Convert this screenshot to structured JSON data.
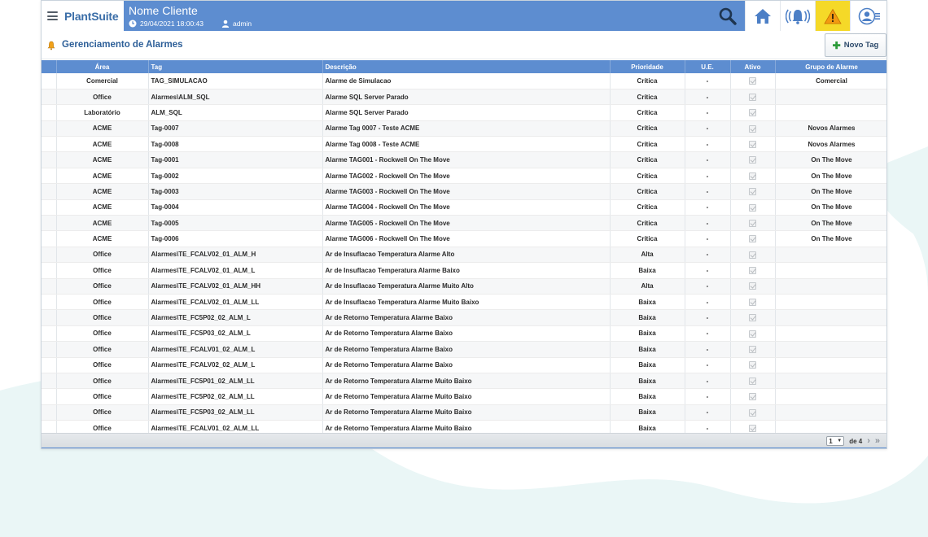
{
  "app": {
    "brand": "PlantSuite",
    "client_name": "Nome Cliente",
    "datetime": "29/04/2021 18:00:43",
    "user": "admin"
  },
  "page": {
    "title": "Gerenciamento de Alarmes",
    "new_button": "Novo Tag"
  },
  "table": {
    "columns": [
      "Área",
      "Tag",
      "Descrição",
      "Prioridade",
      "U.E.",
      "Ativo",
      "Grupo de Alarme"
    ],
    "rows": [
      {
        "area": "Comercial",
        "tag": "TAG_SIMULACAO",
        "desc": "Alarme de Simulacao",
        "prio": "Crítica",
        "ue": "-",
        "grupo": "Comercial"
      },
      {
        "area": "Office",
        "tag": "Alarmes\\ALM_SQL",
        "desc": "Alarme SQL Server Parado",
        "prio": "Crítica",
        "ue": "-",
        "grupo": ""
      },
      {
        "area": "Laboratório",
        "tag": "ALM_SQL",
        "desc": "Alarme SQL Server Parado",
        "prio": "Crítica",
        "ue": "-",
        "grupo": ""
      },
      {
        "area": "ACME",
        "tag": "Tag-0007",
        "desc": "Alarme Tag 0007 - Teste ACME",
        "prio": "Crítica",
        "ue": "-",
        "grupo": "Novos Alarmes"
      },
      {
        "area": "ACME",
        "tag": "Tag-0008",
        "desc": "Alarme Tag 0008 - Teste ACME",
        "prio": "Crítica",
        "ue": "-",
        "grupo": "Novos Alarmes"
      },
      {
        "area": "ACME",
        "tag": "Tag-0001",
        "desc": "Alarme TAG001 - Rockwell On The Move",
        "prio": "Crítica",
        "ue": "-",
        "grupo": "On The Move"
      },
      {
        "area": "ACME",
        "tag": "Tag-0002",
        "desc": "Alarme TAG002 - Rockwell On The Move",
        "prio": "Crítica",
        "ue": "-",
        "grupo": "On The Move"
      },
      {
        "area": "ACME",
        "tag": "Tag-0003",
        "desc": "Alarme TAG003 - Rockwell On The Move",
        "prio": "Crítica",
        "ue": "-",
        "grupo": "On The Move"
      },
      {
        "area": "ACME",
        "tag": "Tag-0004",
        "desc": "Alarme TAG004 - Rockwell On The Move",
        "prio": "Crítica",
        "ue": "-",
        "grupo": "On The Move"
      },
      {
        "area": "ACME",
        "tag": "Tag-0005",
        "desc": "Alarme TAG005 - Rockwell On The Move",
        "prio": "Crítica",
        "ue": "-",
        "grupo": "On The Move"
      },
      {
        "area": "ACME",
        "tag": "Tag-0006",
        "desc": "Alarme TAG006 - Rockwell On The Move",
        "prio": "Crítica",
        "ue": "-",
        "grupo": "On The Move"
      },
      {
        "area": "Office",
        "tag": "Alarmes\\TE_FCALV02_01_ALM_H",
        "desc": "Ar de Insuflacao Temperatura Alarme Alto",
        "prio": "Alta",
        "ue": "-",
        "grupo": ""
      },
      {
        "area": "Office",
        "tag": "Alarmes\\TE_FCALV02_01_ALM_L",
        "desc": "Ar de Insuflacao Temperatura Alarme Baixo",
        "prio": "Baixa",
        "ue": "-",
        "grupo": ""
      },
      {
        "area": "Office",
        "tag": "Alarmes\\TE_FCALV02_01_ALM_HH",
        "desc": "Ar de Insuflacao Temperatura Alarme Muito Alto",
        "prio": "Alta",
        "ue": "-",
        "grupo": ""
      },
      {
        "area": "Office",
        "tag": "Alarmes\\TE_FCALV02_01_ALM_LL",
        "desc": "Ar de Insuflacao Temperatura Alarme Muito Baixo",
        "prio": "Baixa",
        "ue": "-",
        "grupo": ""
      },
      {
        "area": "Office",
        "tag": "Alarmes\\TE_FC5P02_02_ALM_L",
        "desc": "Ar de Retorno Temperatura Alarme Baixo",
        "prio": "Baixa",
        "ue": "-",
        "grupo": ""
      },
      {
        "area": "Office",
        "tag": "Alarmes\\TE_FC5P03_02_ALM_L",
        "desc": "Ar de Retorno Temperatura Alarme Baixo",
        "prio": "Baixa",
        "ue": "-",
        "grupo": ""
      },
      {
        "area": "Office",
        "tag": "Alarmes\\TE_FCALV01_02_ALM_L",
        "desc": "Ar de Retorno Temperatura Alarme Baixo",
        "prio": "Baixa",
        "ue": "-",
        "grupo": ""
      },
      {
        "area": "Office",
        "tag": "Alarmes\\TE_FCALV02_02_ALM_L",
        "desc": "Ar de Retorno Temperatura Alarme Baixo",
        "prio": "Baixa",
        "ue": "-",
        "grupo": ""
      },
      {
        "area": "Office",
        "tag": "Alarmes\\TE_FC5P01_02_ALM_LL",
        "desc": "Ar de Retorno Temperatura Alarme Muito Baixo",
        "prio": "Baixa",
        "ue": "-",
        "grupo": ""
      },
      {
        "area": "Office",
        "tag": "Alarmes\\TE_FC5P02_02_ALM_LL",
        "desc": "Ar de Retorno Temperatura Alarme Muito Baixo",
        "prio": "Baixa",
        "ue": "-",
        "grupo": ""
      },
      {
        "area": "Office",
        "tag": "Alarmes\\TE_FC5P03_02_ALM_LL",
        "desc": "Ar de Retorno Temperatura Alarme Muito Baixo",
        "prio": "Baixa",
        "ue": "-",
        "grupo": ""
      },
      {
        "area": "Office",
        "tag": "Alarmes\\TE_FCALV01_02_ALM_LL",
        "desc": "Ar de Retorno Temperatura Alarme Muito Baixo",
        "prio": "Baixa",
        "ue": "-",
        "grupo": ""
      }
    ]
  },
  "pager": {
    "current_page": "1",
    "total_label": "de 4"
  },
  "nav_icons": [
    "search-icon",
    "home-icon",
    "broadcast-alarm-icon",
    "warning-icon",
    "user-menu-icon"
  ],
  "colors": {
    "header_blue": "#5d8dd0",
    "warning_yellow": "#f5d928",
    "background_wave": "#e9f6f6"
  }
}
